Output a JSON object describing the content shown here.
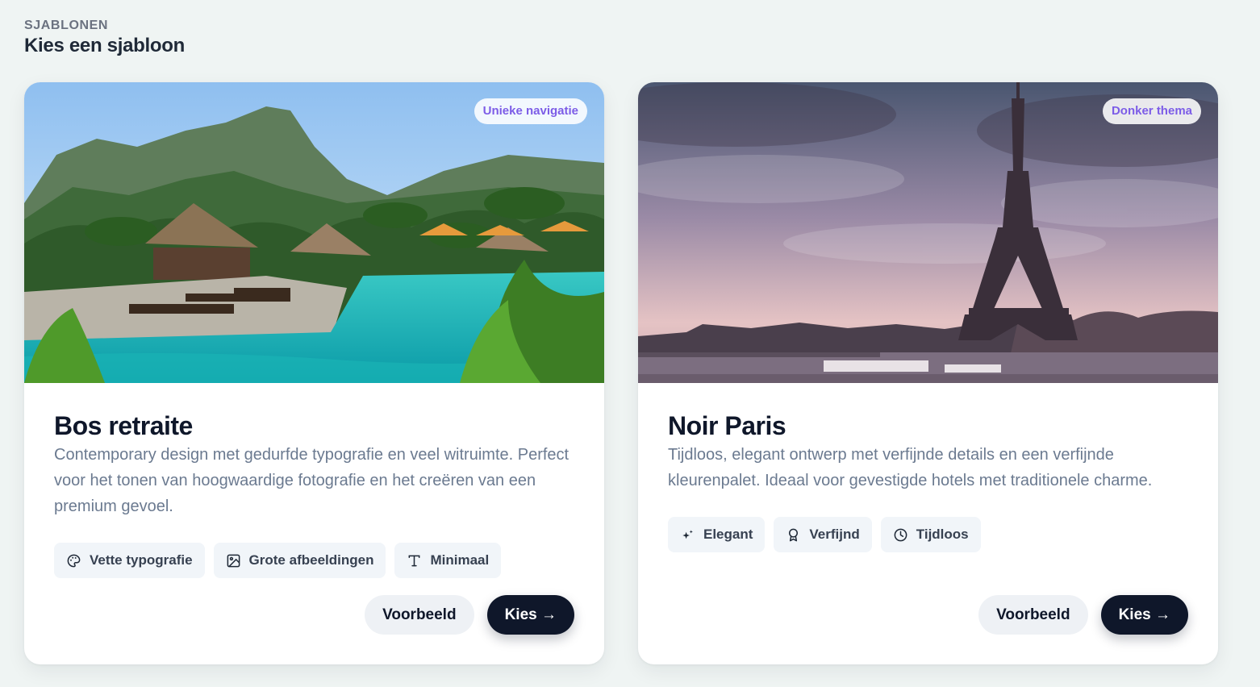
{
  "section": {
    "eyebrow": "SJABLONEN",
    "title": "Kies een sjabloon"
  },
  "templates": [
    {
      "badge": "Unieke navigatie",
      "title": "Bos retraite",
      "description": "Contemporary design met gedurfde typografie en veel witruimte. Perfect voor het tonen van hoogwaardige fotografie en het creëren van een premium gevoel.",
      "image": "tropical-resort-pool-photo",
      "tags": [
        {
          "icon": "palette-icon",
          "label": "Vette typografie"
        },
        {
          "icon": "image-icon",
          "label": "Grote afbeeldingen"
        },
        {
          "icon": "type-icon",
          "label": "Minimaal"
        }
      ],
      "preview_label": "Voorbeeld",
      "choose_label": "Kies →"
    },
    {
      "badge": "Donker thema",
      "title": "Noir Paris",
      "description": "Tijdloos, elegant ontwerp met verfijnde details en een verfijnde kleurenpalet. Ideaal voor gevestigde hotels met traditionele charme.",
      "image": "eiffel-tower-dusk-photo",
      "tags": [
        {
          "icon": "sparkles-icon",
          "label": "Elegant"
        },
        {
          "icon": "award-icon",
          "label": "Verfijnd"
        },
        {
          "icon": "clock-icon",
          "label": "Tijdloos"
        }
      ],
      "preview_label": "Voorbeeld",
      "choose_label": "Kies →"
    }
  ],
  "colors": {
    "background": "#eff4f3",
    "badge_text": "#7c5ce7",
    "primary_button": "#0f172a",
    "secondary_button": "#eef1f5"
  }
}
